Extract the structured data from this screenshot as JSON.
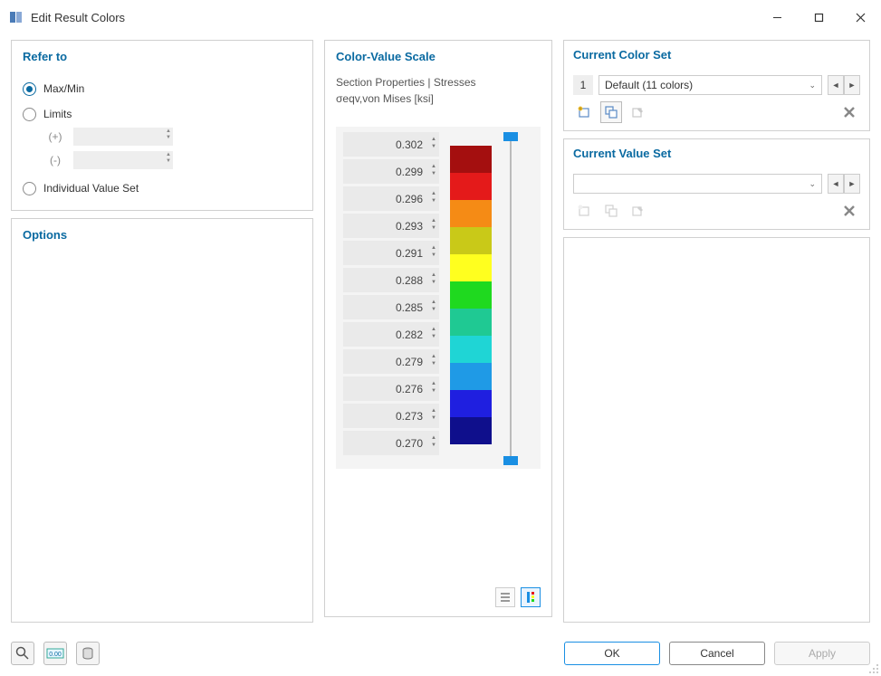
{
  "window": {
    "title": "Edit Result Colors"
  },
  "refer": {
    "title": "Refer to",
    "opt_maxmin": "Max/Min",
    "opt_limits": "Limits",
    "plus": "(+)",
    "minus": "(-)",
    "opt_individual": "Individual Value Set"
  },
  "options": {
    "title": "Options"
  },
  "cvs": {
    "title": "Color-Value Scale",
    "line1": "Section Properties | Stresses",
    "line2": "σeqv,von Mises [ksi]",
    "values": [
      "0.302",
      "0.299",
      "0.296",
      "0.293",
      "0.291",
      "0.288",
      "0.285",
      "0.282",
      "0.279",
      "0.276",
      "0.273",
      "0.270"
    ],
    "colors": [
      "#a40f0f",
      "#e41a1a",
      "#f58b15",
      "#c9c918",
      "#ffff1f",
      "#1fd91f",
      "#1fc993",
      "#1fd5d5",
      "#1f9ae6",
      "#1f1fe0",
      "#0f0f8c"
    ]
  },
  "cset": {
    "title": "Current Color Set",
    "index": "1",
    "selected": "Default (11 colors)"
  },
  "vset": {
    "title": "Current Value Set",
    "selected": ""
  },
  "footer": {
    "ok": "OK",
    "cancel": "Cancel",
    "apply": "Apply"
  }
}
